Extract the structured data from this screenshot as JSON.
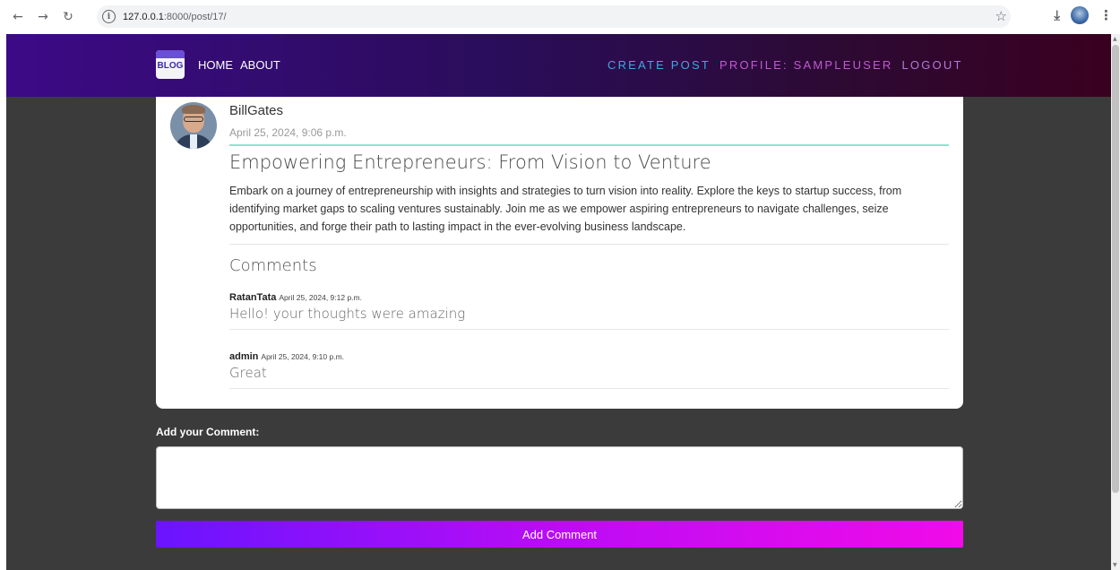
{
  "browser": {
    "url_host": "127.0.0.1",
    "url_path": ":8000/post/17/"
  },
  "navbar": {
    "logo_text": "BLOG",
    "home": "HOME",
    "about": "ABOUT",
    "create_post": "CREATE POST",
    "profile": "PROFILE: SAMPLEUSER",
    "logout": "LOGOUT"
  },
  "post": {
    "author": "BillGates",
    "date": "April 25, 2024, 9:06 p.m.",
    "title": "Empowering Entrepreneurs: From Vision to Venture",
    "body": "Embark on a journey of entrepreneurship with insights and strategies to turn vision into reality. Explore the keys to startup success, from identifying market gaps to scaling ventures sustainably. Join me as we empower aspiring entrepreneurs to navigate challenges, seize opportunities, and forge their path to lasting impact in the ever-evolving business landscape."
  },
  "comments": {
    "heading": "Comments",
    "items": [
      {
        "author": "RatanTata",
        "date": "April 25, 2024, 9:12 p.m.",
        "text": "Hello! your thoughts were amazing"
      },
      {
        "author": "admin",
        "date": "April 25, 2024, 9:10 p.m.",
        "text": "Great"
      }
    ]
  },
  "add_comment": {
    "label": "Add your Comment:",
    "value": "",
    "button": "Add Comment"
  },
  "colors": {
    "accent_line": "#8ee3cf",
    "button_start": "#6a14ff",
    "button_end": "#f10be8",
    "page_bg": "#3b3b3b"
  }
}
